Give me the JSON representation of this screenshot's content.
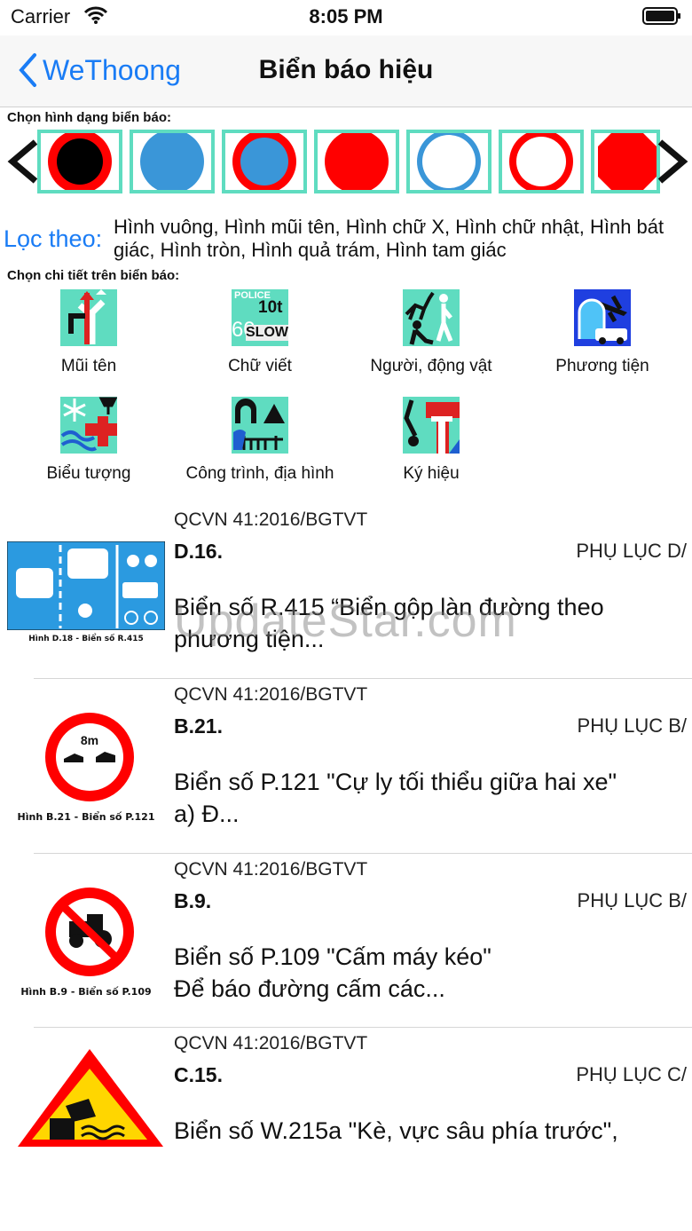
{
  "status_bar": {
    "carrier": "Carrier",
    "time": "8:05 PM"
  },
  "nav": {
    "back_label": "WeThoong",
    "title": "Biển báo hiệu"
  },
  "shape_section": {
    "label": "Chọn hình dạng biển báo:",
    "shapes": [
      "black-disc-red-ring",
      "blue-disc",
      "blue-disc-red-ring",
      "red-disc",
      "white-disc-blue-ring",
      "white-disc-red-ring",
      "red-octagon"
    ]
  },
  "filter": {
    "label": "Lọc theo:",
    "value": "Hình vuông, Hình mũi tên, Hình chữ X, Hình chữ nhật, Hình bát giác, Hình tròn, Hình quả trám, Hình tam giác"
  },
  "detail_section": {
    "label": "Chọn chi tiết trên biển báo:",
    "categories": [
      {
        "label": "Mũi tên",
        "icon": "arrow-sign-icon"
      },
      {
        "label": "Chữ viết",
        "icon": "text-sign-icon",
        "icon_text_top": "POLICE",
        "icon_text_mid": "10t",
        "icon_text_bottom": "SLOW",
        "icon_text_num": "60"
      },
      {
        "label": "Người, động vật",
        "icon": "people-animal-icon"
      },
      {
        "label": "Phương tiện",
        "icon": "vehicle-icon"
      },
      {
        "label": "Biểu tượng",
        "icon": "symbol-icon"
      },
      {
        "label": "Công trình, địa hình",
        "icon": "structure-terrain-icon"
      },
      {
        "label": "Ký hiệu",
        "icon": "notation-icon"
      }
    ]
  },
  "results": [
    {
      "source": "QCVN 41:2016/BGTVT",
      "code": "D.16.",
      "appendix": "PHỤ LỤC D/",
      "desc_line1": "Biển số R.415 “Biển gộp làn đường theo",
      "desc_line2": "phương tiện...",
      "caption": "Hình D.18 - Biển số R.415"
    },
    {
      "source": "QCVN 41:2016/BGTVT",
      "code": "B.21.",
      "appendix": "PHỤ LỤC B/",
      "desc_line1": "Biển số P.121 \"Cự ly tối thiểu giữa hai xe\"",
      "desc_line2": " a) Đ...",
      "caption": "Hình B.21 - Biển số P.121",
      "sign_text": "8m"
    },
    {
      "source": "QCVN 41:2016/BGTVT",
      "code": "B.9.",
      "appendix": "PHỤ LỤC B/",
      "desc_line1": "Biển số P.109 \"Cấm máy kéo\"",
      "desc_line2": " Để báo đường cấm các...",
      "caption": "Hình B.9 - Biển số P.109"
    },
    {
      "source": "QCVN 41:2016/BGTVT",
      "code": "C.15.",
      "appendix": "PHỤ LỤC C/",
      "desc_line1": "Biển số W.215a \"Kè, vực sâu phía trước\",",
      "desc_line2": ""
    }
  ],
  "watermark": "UpdateStar.com",
  "colors": {
    "accent": "#1a7cf5",
    "teal": "#5fdcc0",
    "sign_red": "#ff0000",
    "sign_blue": "#3a96d8"
  }
}
